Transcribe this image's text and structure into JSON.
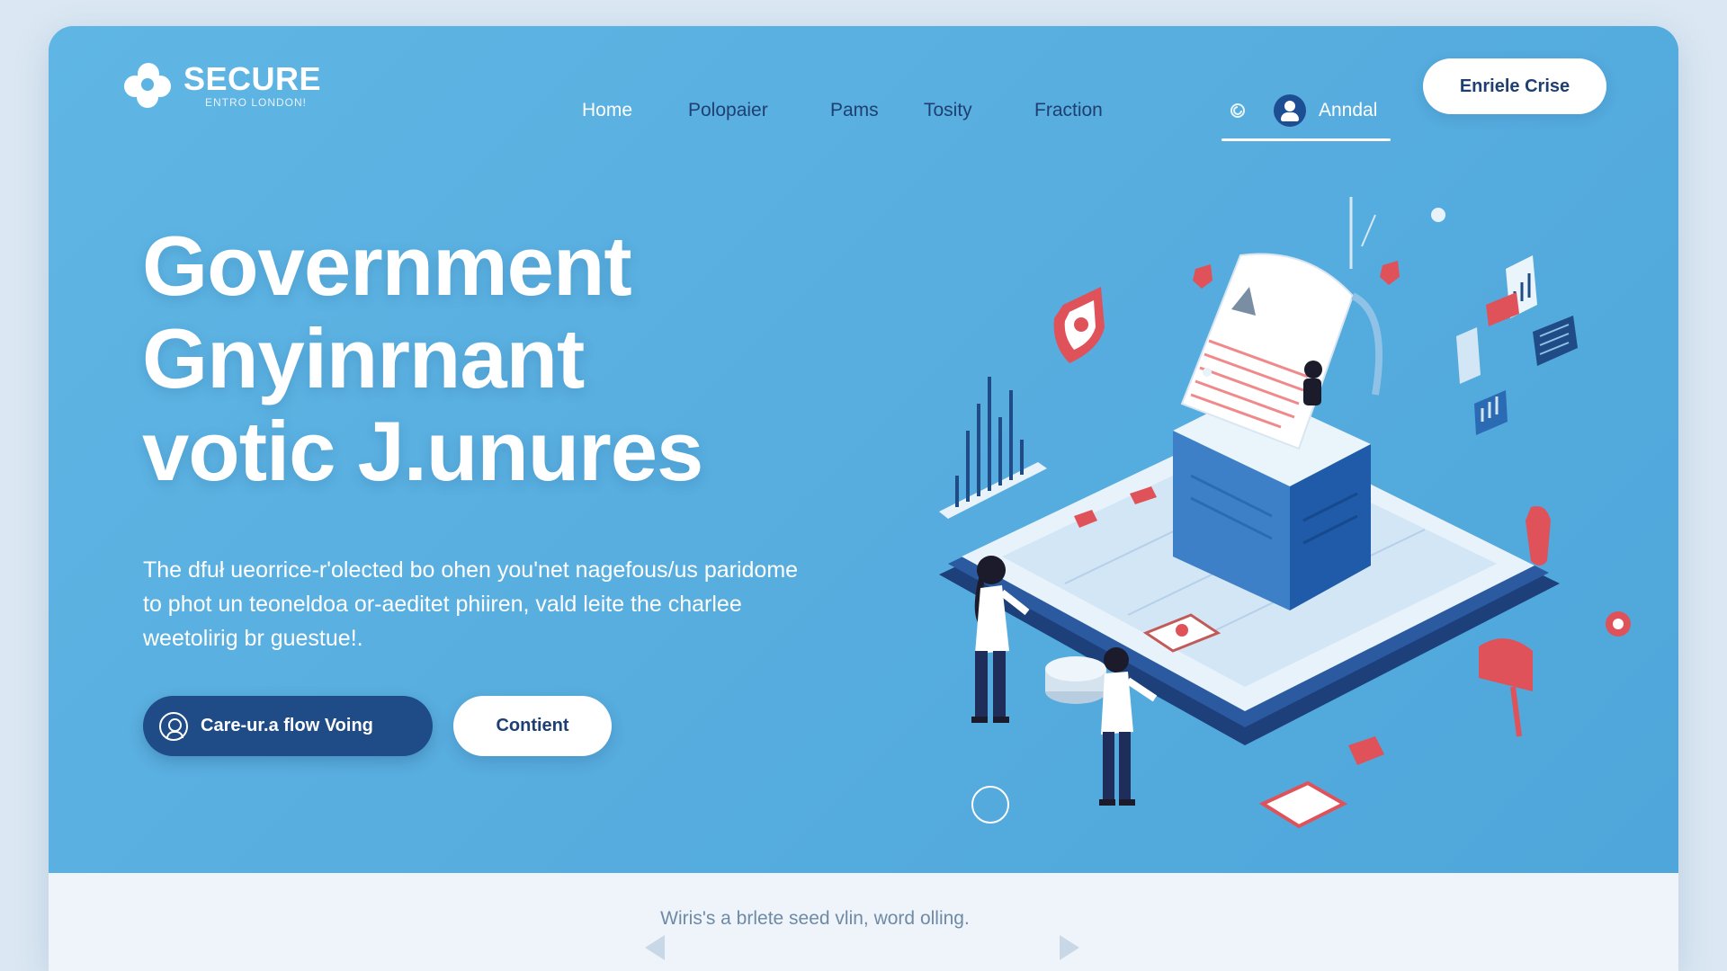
{
  "brand": {
    "name": "SECURE",
    "subtitle": "ENTRO LONDON!"
  },
  "nav": {
    "items": [
      {
        "label": "Home"
      },
      {
        "label": "Polopaier"
      },
      {
        "label": "Pams"
      },
      {
        "label": "Tosity"
      },
      {
        "label": "Fraction"
      }
    ]
  },
  "user": {
    "name": "Anndal"
  },
  "header": {
    "cta_label": "Enriele Crise"
  },
  "hero": {
    "headline": [
      "Government",
      "Gnyinrnant",
      "votic J.unures"
    ],
    "description": "The dfuł ueorrice-r'olected bo ohen you'net nagefous/us paridome to phot un teoneldoa or-aeditet phiiren, vald leite the charlee weetolirig br guestue!.",
    "primary_button": "Care-ur.a flow Voing",
    "secondary_button": "Contient"
  },
  "footer": {
    "tagline": "Wiris's a brlete seed vlin, word olling."
  },
  "colors": {
    "hero_bg": "#5db3e2",
    "primary": "#1f4b86",
    "accent_red": "#e0525a",
    "text_dark": "#1f3f72"
  }
}
